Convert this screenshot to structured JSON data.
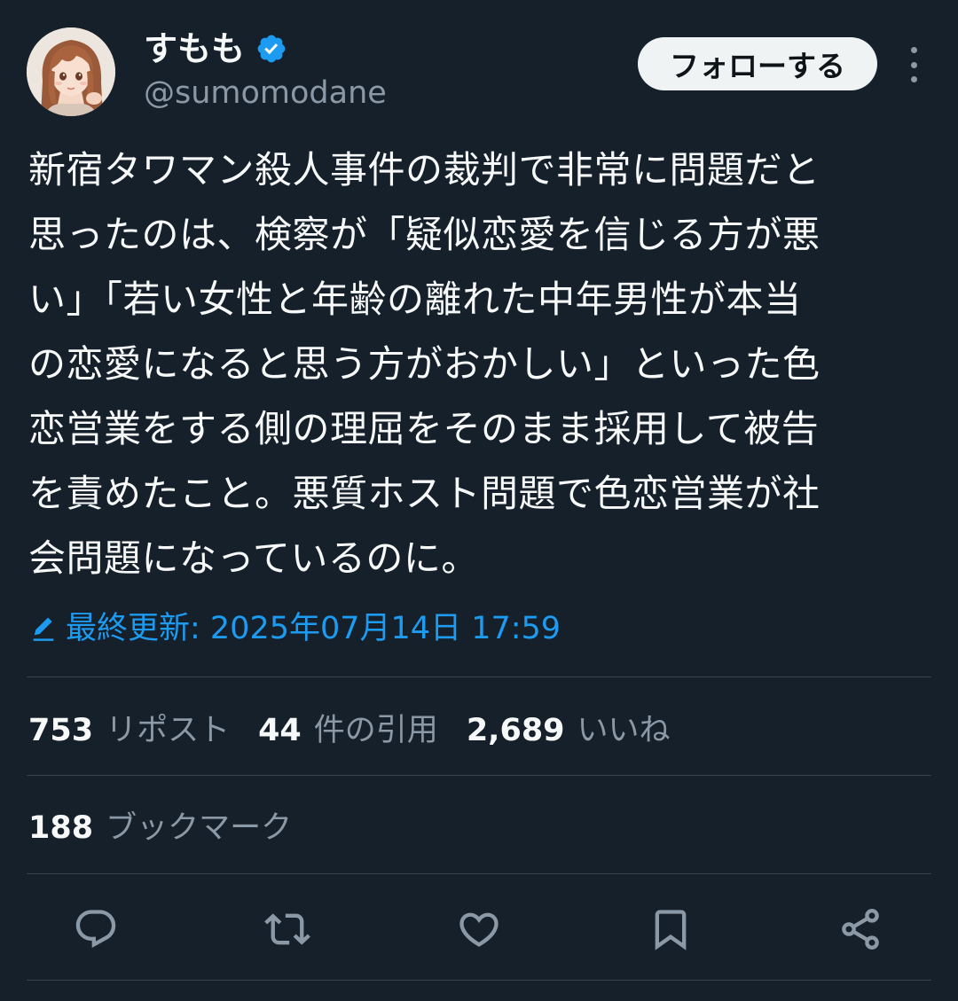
{
  "user": {
    "display_name": "すもも",
    "handle": "@sumomodane",
    "verified": true
  },
  "follow_button": {
    "label": "フォローする"
  },
  "more_icon": "more-vertical-icon",
  "tweet": {
    "text": "新宿タワマン殺人事件の裁判で非常に問題だと\n思ったのは、検察が「疑似恋愛を信じる方が悪\nい」「若い女性と年齢の離れた中年男性が本当\nの恋愛になると思う方がおかしい」といった色\n恋営業をする側の理屈をそのまま採用して被告\nを責めたこと。悪質ホスト問題で色恋営業が社\n会問題になっているのに。",
    "edited_label": "最終更新: 2025年07月14日 17:59"
  },
  "stats": {
    "reposts": {
      "count": "753",
      "label": "リポスト"
    },
    "quotes": {
      "count": "44",
      "label": "件の引用"
    },
    "likes": {
      "count": "2,689",
      "label": "いいね"
    },
    "bookmarks": {
      "count": "188",
      "label": "ブックマーク"
    }
  },
  "actions": [
    "reply-icon",
    "repost-icon",
    "like-icon",
    "bookmark-icon",
    "share-icon"
  ],
  "colors": {
    "background": "#15202b",
    "text": "#f7f9f9",
    "muted": "#8b98a5",
    "accent": "#1d9bf0",
    "divider": "#38444d",
    "follow_bg": "#eff3f4"
  }
}
